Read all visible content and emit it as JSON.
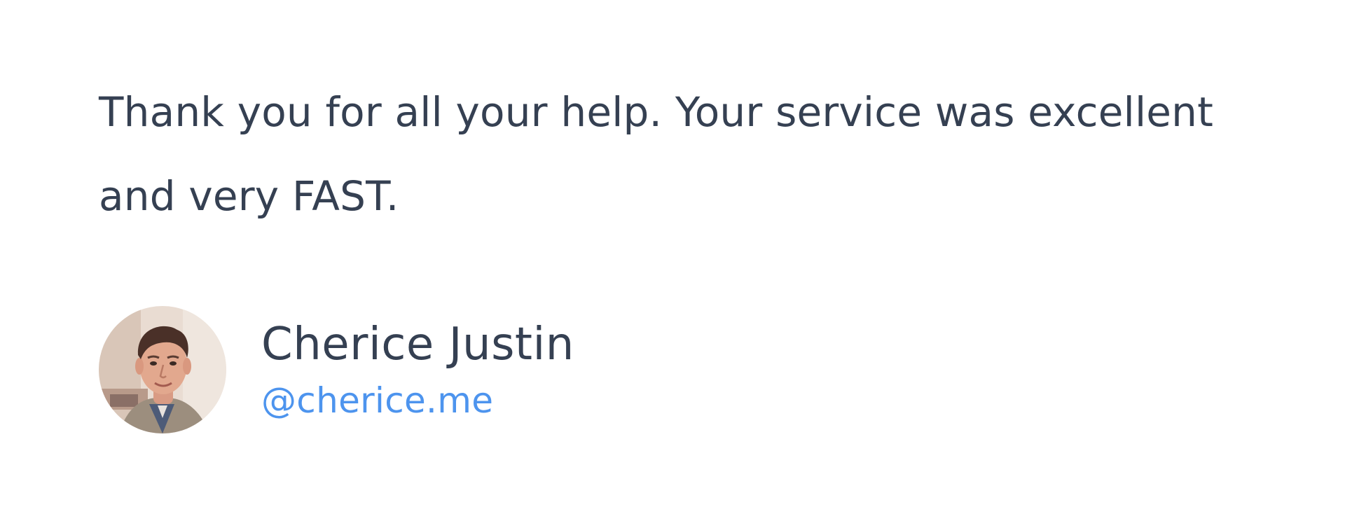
{
  "testimonial": {
    "quote": "Thank you for all your help. Your service was excellent and very FAST.",
    "author": {
      "name": "Cherice Justin",
      "handle": "@cherice.me",
      "avatar_icon": "user-photo-avatar"
    }
  },
  "colors": {
    "text": "#354052",
    "link": "#4d94ee",
    "background": "#ffffff"
  }
}
